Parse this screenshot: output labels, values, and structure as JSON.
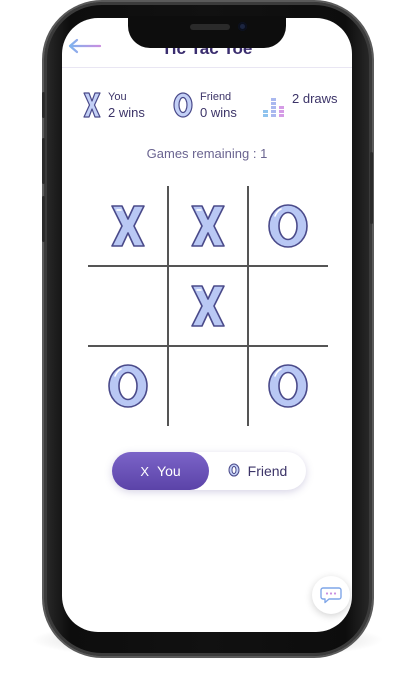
{
  "app": {
    "title": "Tic Tac Toe"
  },
  "scores": {
    "you": {
      "label": "You",
      "wins": "2 wins"
    },
    "friend": {
      "label": "Friend",
      "wins": "0 wins"
    },
    "draws": {
      "text": "2 draws"
    }
  },
  "games_remaining": "Games remaining : 1",
  "board": {
    "cells": [
      "X",
      "X",
      "O",
      "",
      "X",
      "",
      "O",
      "",
      "O"
    ]
  },
  "turn_toggle": {
    "you": {
      "symbol": "X",
      "label": "You",
      "active": true
    },
    "friend": {
      "symbol": "O",
      "label": "Friend",
      "active": false
    }
  },
  "icons": {
    "back": "arrow-left-icon",
    "draws": "bar-grid-icon",
    "chat": "chat-bubble-icon"
  },
  "colors": {
    "accent": "#5b43a8",
    "mark_fill": "#b9c8f4",
    "mark_stroke": "#4a4a8a",
    "title": "#3a2d6e"
  }
}
